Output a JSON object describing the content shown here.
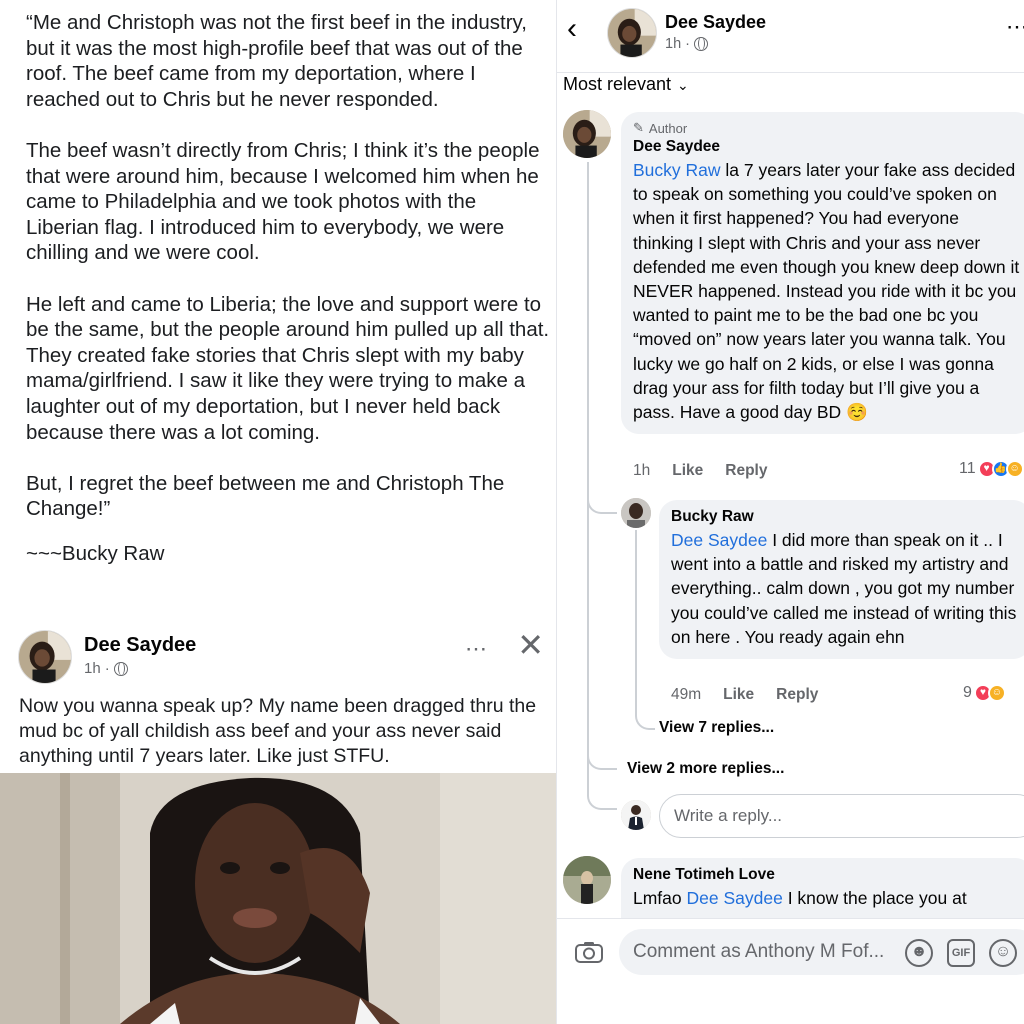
{
  "left": {
    "quote": {
      "p1": "“Me and Christoph was not the first beef in the industry, but it was the most high-profile beef that was out of the roof. The beef came from my deportation, where I reached out to Chris but he never responded.",
      "p2": "The beef wasn’t directly from Chris; I think it’s the people that were around him, because I welcomed him when he came to Philadelphia and we took photos with the Liberian flag. I introduced him to everybody, we were chilling and we were cool.",
      "p3": "He left and came to Liberia; the love and support were to be the same, but the people around him pulled up all that. They created fake stories that Chris slept with my baby mama/girlfriend. I saw it like they were trying to make a laughter out of my deportation, but I never held back because there was a lot coming.",
      "p4": "But, I regret the beef between me and Christoph The Change!”",
      "signature": "~~~Bucky Raw"
    },
    "post": {
      "author": "Dee Saydee",
      "time": "1h",
      "more_icon": "⋯",
      "close_icon": "✕",
      "text": "Now you wanna speak up? My name been dragged thru the mud bc of yall childish ass beef and your ass never said anything until 7 years later. Like just STFU."
    }
  },
  "right": {
    "header": {
      "back_icon": "‹",
      "author": "Dee Saydee",
      "time": "1h",
      "more_icon": "⋯"
    },
    "sort_label": "Most relevant",
    "comments": [
      {
        "badge": "Author",
        "name": "Dee Saydee",
        "mention": "Bucky Raw",
        "text": " la 7 years later your fake ass decided to speak on something you could’ve spoken on when it first happened? You had everyone thinking I slept with Chris and your ass never defended me even though you knew deep down it NEVER happened. Instead you ride with it bc you wanted to paint me to be the bad one bc you “moved on” now years later you wanna talk. You lucky we go half on 2 kids, or else I was gonna drag your ass for filth today but I’ll give you a pass. Have a good day BD ☺️",
        "time": "1h",
        "like": "Like",
        "reply": "Reply",
        "reactions": "11"
      },
      {
        "name": "Bucky Raw",
        "mention": "Dee Saydee",
        "text": " I did more than speak on it .. I went into a battle and risked my artistry and everything.. calm down , you got my number you could’ve  called me instead of writing this on here . You ready again ehn",
        "time": "49m",
        "like": "Like",
        "reply": "Reply",
        "reactions": "9"
      }
    ],
    "view_7": "View 7 replies...",
    "view_2": "View 2 more replies...",
    "reply_placeholder": "Write a reply...",
    "third_comment": {
      "name": "Nene Totimeh Love",
      "prefix": "Lmfao ",
      "mention": "Dee Saydee",
      "text": " I know the place you at"
    },
    "bottom": {
      "comment_placeholder": "Comment as Anthony M Fof...",
      "gif_label": "GIF"
    }
  }
}
